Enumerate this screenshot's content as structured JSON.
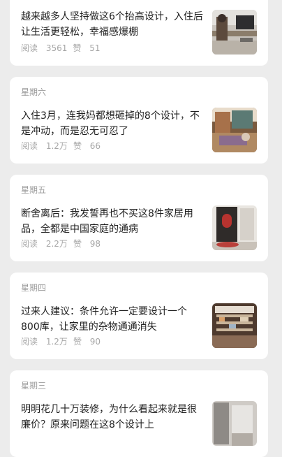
{
  "articles": [
    {
      "day": "",
      "title": "越来越多人坚持做这6个抬高设计，入住后让生活更轻松，幸福感爆棚",
      "reads_label": "阅读",
      "reads": "3561",
      "likes_label": "赞",
      "likes": "51",
      "thumb_icon": "office-desk-photo"
    },
    {
      "day": "星期六",
      "title": "入住3月，连我妈都想砸掉的8个设计，不是冲动，而是忍无可忍了",
      "reads_label": "阅读",
      "reads": "1.2万",
      "likes_label": "赞",
      "likes": "66",
      "thumb_icon": "living-room-photo"
    },
    {
      "day": "星期五",
      "title": "断舍离后：我发誓再也不买这8件家居用品，全都是中国家庭的通病",
      "reads_label": "阅读",
      "reads": "2.2万",
      "likes_label": "赞",
      "likes": "98",
      "thumb_icon": "entry-door-photo"
    },
    {
      "day": "星期四",
      "title": "过来人建议：条件允许一定要设计一个800库，让家里的杂物通通消失",
      "reads_label": "阅读",
      "reads": "1.2万",
      "likes_label": "赞",
      "likes": "90",
      "thumb_icon": "storage-room-photo"
    },
    {
      "day": "星期三",
      "title": "明明花几十万装修，为什么看起来就是很廉价？原来问题在这8个设计上",
      "reads_label": "",
      "reads": "",
      "likes_label": "",
      "likes": "",
      "thumb_icon": "interior-photo"
    }
  ]
}
